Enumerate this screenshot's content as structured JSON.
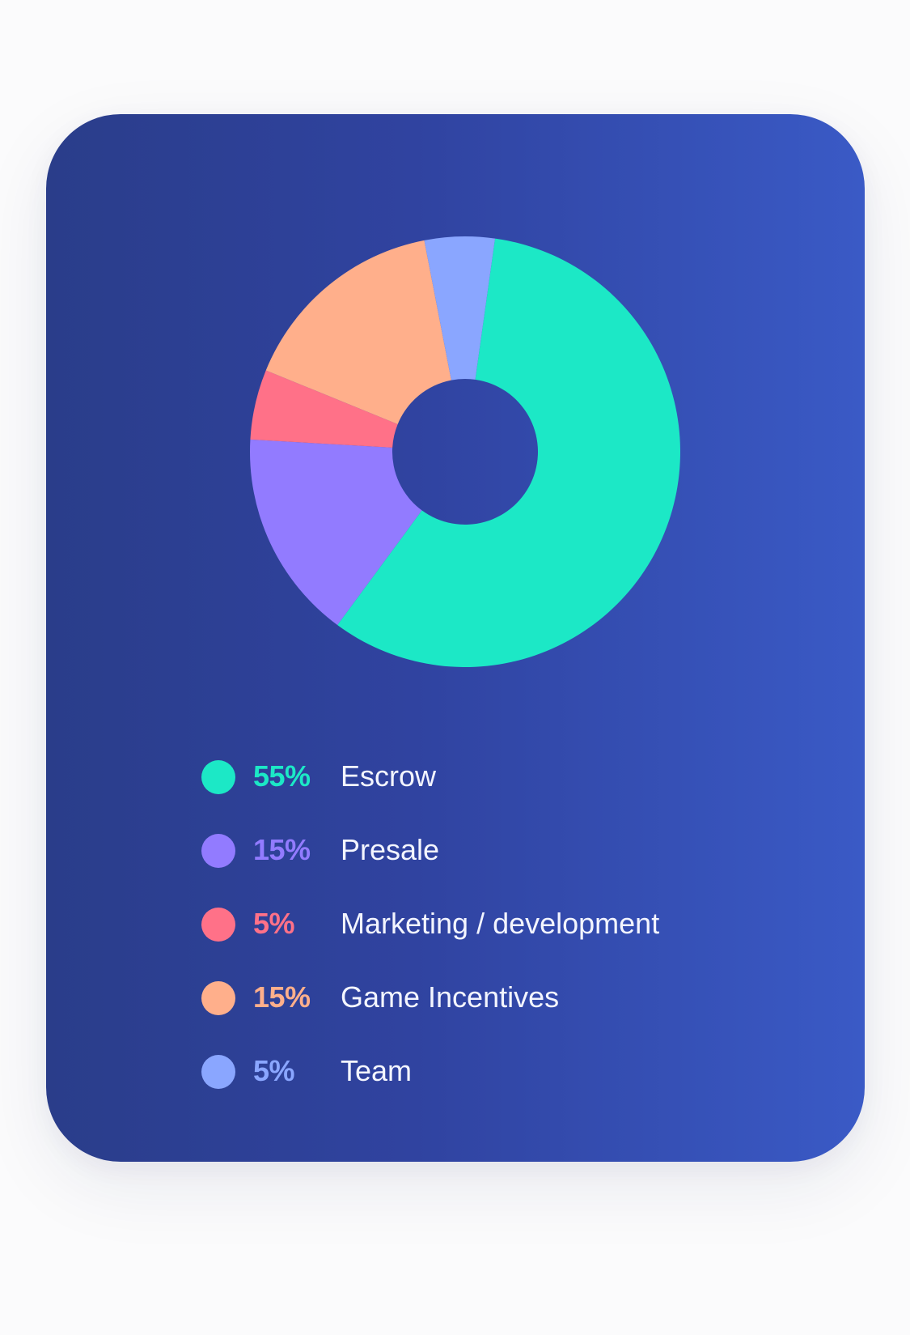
{
  "chart_data": {
    "type": "pie",
    "title": "",
    "series": [
      {
        "label": "Escrow",
        "value": 55,
        "percent_label": "55%",
        "color": "#1ce8c6"
      },
      {
        "label": "Presale",
        "value": 15,
        "percent_label": "15%",
        "color": "#927bff"
      },
      {
        "label": "Marketing / development",
        "value": 5,
        "percent_label": "5%",
        "color": "#ff7188"
      },
      {
        "label": "Game Incentives",
        "value": 15,
        "percent_label": "15%",
        "color": "#ffaf8b"
      },
      {
        "label": "Team",
        "value": 5,
        "percent_label": "5%",
        "color": "#8aa6ff"
      }
    ],
    "legend": "below"
  },
  "colors": {
    "card_gradient_start": "#2a3d8a",
    "card_gradient_end": "#3a5ac6",
    "label_text": "#f3f5ff"
  }
}
